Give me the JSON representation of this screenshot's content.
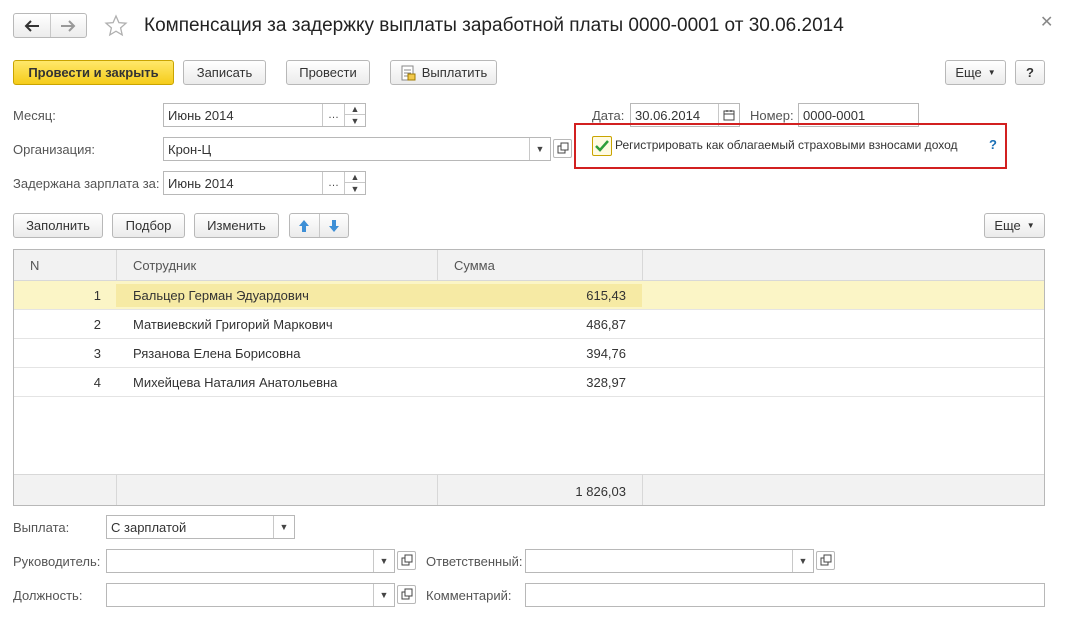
{
  "title": "Компенсация за задержку выплаты заработной платы 0000-0001 от 30.06.2014",
  "toolbar": {
    "post_close": "Провести и закрыть",
    "save": "Записать",
    "post": "Провести",
    "pay": "Выплатить",
    "more": "Еще",
    "help": "?"
  },
  "form": {
    "month_label": "Месяц:",
    "month_value": "Июнь 2014",
    "org_label": "Организация:",
    "org_value": "Крон-Ц",
    "delayed_label": "Задержана зарплата за:",
    "delayed_value": "Июнь 2014",
    "date_label": "Дата:",
    "date_value": "30.06.2014",
    "number_label": "Номер:",
    "number_value": "0000-0001",
    "register_label": "Регистрировать как облагаемый страховыми взносами доход",
    "register_checked": true,
    "register_help": "?"
  },
  "table_toolbar": {
    "fill": "Заполнить",
    "pick": "Подбор",
    "change": "Изменить",
    "more": "Еще"
  },
  "table": {
    "columns": [
      "N",
      "Сотрудник",
      "Сумма"
    ],
    "rows": [
      {
        "n": "1",
        "employee": "Бальцер Герман Эдуардович",
        "sum": "615,43"
      },
      {
        "n": "2",
        "employee": "Матвиевский Григорий Маркович",
        "sum": "486,87"
      },
      {
        "n": "3",
        "employee": "Рязанова Елена Борисовна",
        "sum": "394,76"
      },
      {
        "n": "4",
        "employee": "Михейцева Наталия Анатольевна",
        "sum": "328,97"
      }
    ],
    "total": "1 826,03"
  },
  "footer": {
    "payment_label": "Выплата:",
    "payment_value": "С зарплатой",
    "head_label": "Руководитель:",
    "head_value": "",
    "responsible_label": "Ответственный:",
    "responsible_value": "",
    "position_label": "Должность:",
    "position_value": "",
    "comment_label": "Комментарий:",
    "comment_value": ""
  },
  "colors": {
    "primary_button": "#f5cc1a",
    "highlight_border": "#d22020",
    "selected_row": "#fbf5c6",
    "help_link": "#1a6fb5"
  }
}
